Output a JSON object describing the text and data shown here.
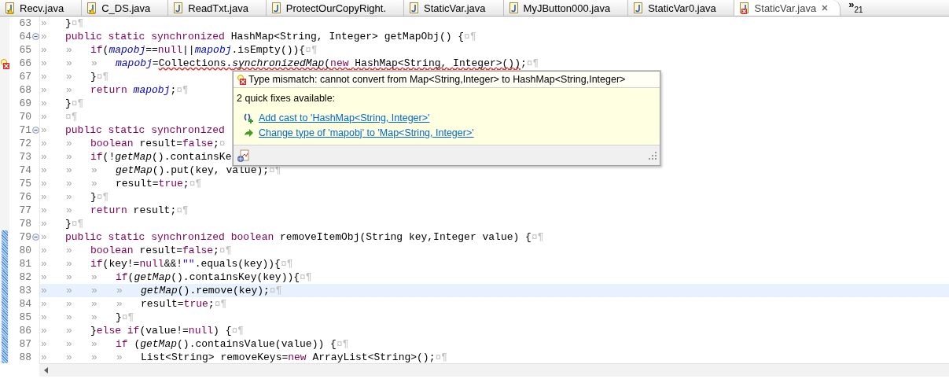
{
  "tabs": [
    {
      "label": "Recv.java",
      "warning": true,
      "error": false,
      "selected": false
    },
    {
      "label": "C_DS.java",
      "warning": true,
      "error": false,
      "selected": false
    },
    {
      "label": "ReadTxt.java",
      "warning": false,
      "error": false,
      "selected": false
    },
    {
      "label": "ProtectOurCopyRight.",
      "warning": false,
      "error": false,
      "selected": false
    },
    {
      "label": "StaticVar.java",
      "warning": false,
      "error": false,
      "selected": false
    },
    {
      "label": "MyJButton000.java",
      "warning": false,
      "error": false,
      "selected": false
    },
    {
      "label": "StaticVar0.java",
      "warning": false,
      "error": false,
      "selected": false
    },
    {
      "label": "StaticVar.java",
      "warning": false,
      "error": true,
      "selected": true
    }
  ],
  "overflow": {
    "chevron": "»",
    "count": "21"
  },
  "editor": {
    "lines": [
      {
        "number": "63",
        "foldable": false,
        "error": false,
        "changed": false,
        "current": false,
        "tokens": [
          {
            "kind": "tab",
            "text": "»"
          },
          {
            "kind": "plain",
            "text": "}"
          },
          {
            "kind": "eol",
            "text": "¤¶"
          }
        ]
      },
      {
        "number": "64",
        "foldable": true,
        "error": false,
        "changed": false,
        "current": false,
        "tokens": [
          {
            "kind": "tab",
            "text": "»"
          },
          {
            "kind": "keyword",
            "text": "public static synchronized"
          },
          {
            "kind": "plain",
            "text": " HashMap<String, Integer> getMapObj() {"
          },
          {
            "kind": "eol",
            "text": "¤¶"
          }
        ]
      },
      {
        "number": "65",
        "foldable": false,
        "error": false,
        "changed": false,
        "current": false,
        "tokens": [
          {
            "kind": "tab",
            "text": "»"
          },
          {
            "kind": "tab",
            "text": "»"
          },
          {
            "kind": "keyword",
            "text": "if"
          },
          {
            "kind": "plain",
            "text": "("
          },
          {
            "kind": "field",
            "text": "mapobj"
          },
          {
            "kind": "plain",
            "text": "=="
          },
          {
            "kind": "keyword",
            "text": "null"
          },
          {
            "kind": "plain",
            "text": "||"
          },
          {
            "kind": "field",
            "text": "mapobj"
          },
          {
            "kind": "plain",
            "text": ".isEmpty()){"
          },
          {
            "kind": "eol",
            "text": "¤¶"
          }
        ]
      },
      {
        "number": "66",
        "foldable": false,
        "error": true,
        "changed": false,
        "current": false,
        "tokens": [
          {
            "kind": "tab",
            "text": "»"
          },
          {
            "kind": "tab",
            "text": "»"
          },
          {
            "kind": "tab",
            "text": "»"
          },
          {
            "kind": "field",
            "text": "mapobj"
          },
          {
            "kind": "plain",
            "text": "="
          },
          {
            "kind": "error",
            "tokens": [
              {
                "kind": "plain",
                "text": "Collections."
              },
              {
                "kind": "static",
                "text": "synchronizedMap"
              },
              {
                "kind": "plain",
                "text": "("
              },
              {
                "kind": "keyword",
                "text": "new"
              },
              {
                "kind": "plain",
                "text": " HashMap<String, Integer>())"
              }
            ]
          },
          {
            "kind": "plain",
            "text": ";"
          },
          {
            "kind": "eol",
            "text": "¤¶"
          }
        ]
      },
      {
        "number": "67",
        "foldable": false,
        "error": false,
        "changed": false,
        "current": false,
        "tokens": [
          {
            "kind": "tab",
            "text": "»"
          },
          {
            "kind": "tab",
            "text": "»"
          },
          {
            "kind": "plain",
            "text": "}"
          },
          {
            "kind": "eol",
            "text": "¤¶"
          }
        ]
      },
      {
        "number": "68",
        "foldable": false,
        "error": false,
        "changed": false,
        "current": false,
        "tokens": [
          {
            "kind": "tab",
            "text": "»"
          },
          {
            "kind": "tab",
            "text": "»"
          },
          {
            "kind": "keyword",
            "text": "return "
          },
          {
            "kind": "field",
            "text": "mapobj"
          },
          {
            "kind": "plain",
            "text": ";"
          },
          {
            "kind": "eol",
            "text": "¤¶"
          }
        ]
      },
      {
        "number": "69",
        "foldable": false,
        "error": false,
        "changed": false,
        "current": false,
        "tokens": [
          {
            "kind": "tab",
            "text": "»"
          },
          {
            "kind": "plain",
            "text": "}"
          },
          {
            "kind": "eol",
            "text": "¤¶"
          }
        ]
      },
      {
        "number": "70",
        "foldable": false,
        "error": false,
        "changed": false,
        "current": false,
        "tokens": [
          {
            "kind": "tab",
            "text": "»"
          },
          {
            "kind": "eol",
            "text": "¤¶"
          }
        ]
      },
      {
        "number": "71",
        "foldable": true,
        "error": false,
        "changed": false,
        "current": false,
        "tokens": [
          {
            "kind": "tab",
            "text": "»"
          },
          {
            "kind": "keyword",
            "text": "public static synchronized"
          }
        ]
      },
      {
        "number": "72",
        "foldable": false,
        "error": false,
        "changed": false,
        "current": false,
        "tokens": [
          {
            "kind": "tab",
            "text": "»"
          },
          {
            "kind": "tab",
            "text": "»"
          },
          {
            "kind": "keyword",
            "text": "boolean"
          },
          {
            "kind": "plain",
            "text": " result="
          },
          {
            "kind": "keyword",
            "text": "false"
          },
          {
            "kind": "plain",
            "text": ";"
          },
          {
            "kind": "eol",
            "text": "¤"
          }
        ]
      },
      {
        "number": "73",
        "foldable": false,
        "error": false,
        "changed": false,
        "current": false,
        "tokens": [
          {
            "kind": "tab",
            "text": "»"
          },
          {
            "kind": "tab",
            "text": "»"
          },
          {
            "kind": "keyword",
            "text": "if"
          },
          {
            "kind": "plain",
            "text": "(!"
          },
          {
            "kind": "static",
            "text": "getMap"
          },
          {
            "kind": "plain",
            "text": "().containsKe"
          }
        ]
      },
      {
        "number": "74",
        "foldable": false,
        "error": false,
        "changed": false,
        "current": false,
        "tokens": [
          {
            "kind": "tab",
            "text": "»"
          },
          {
            "kind": "tab",
            "text": "»"
          },
          {
            "kind": "tab",
            "text": "»"
          },
          {
            "kind": "static",
            "text": "getMap"
          },
          {
            "kind": "plain",
            "text": "().put(key, value);"
          },
          {
            "kind": "eol",
            "text": "¤¶"
          }
        ]
      },
      {
        "number": "75",
        "foldable": false,
        "error": false,
        "changed": false,
        "current": false,
        "tokens": [
          {
            "kind": "tab",
            "text": "»"
          },
          {
            "kind": "tab",
            "text": "»"
          },
          {
            "kind": "tab",
            "text": "»"
          },
          {
            "kind": "plain",
            "text": "result="
          },
          {
            "kind": "keyword",
            "text": "true"
          },
          {
            "kind": "plain",
            "text": ";"
          },
          {
            "kind": "eol",
            "text": "¤¶"
          }
        ]
      },
      {
        "number": "76",
        "foldable": false,
        "error": false,
        "changed": false,
        "current": false,
        "tokens": [
          {
            "kind": "tab",
            "text": "»"
          },
          {
            "kind": "tab",
            "text": "»"
          },
          {
            "kind": "plain",
            "text": "}"
          },
          {
            "kind": "eol",
            "text": "¤¶"
          }
        ]
      },
      {
        "number": "77",
        "foldable": false,
        "error": false,
        "changed": false,
        "current": false,
        "tokens": [
          {
            "kind": "tab",
            "text": "»"
          },
          {
            "kind": "tab",
            "text": "»"
          },
          {
            "kind": "keyword",
            "text": "return"
          },
          {
            "kind": "plain",
            "text": " result;"
          },
          {
            "kind": "eol",
            "text": "¤¶"
          }
        ]
      },
      {
        "number": "78",
        "foldable": false,
        "error": false,
        "changed": false,
        "current": false,
        "tokens": [
          {
            "kind": "tab",
            "text": "»"
          },
          {
            "kind": "plain",
            "text": "}"
          },
          {
            "kind": "eol",
            "text": "¤¶"
          }
        ]
      },
      {
        "number": "79",
        "foldable": true,
        "error": false,
        "changed": true,
        "current": false,
        "tokens": [
          {
            "kind": "tab",
            "text": "»"
          },
          {
            "kind": "keyword",
            "text": "public static synchronized boolean"
          },
          {
            "kind": "plain",
            "text": " removeItemObj(String key,Integer value) {"
          },
          {
            "kind": "eol",
            "text": "¤¶"
          }
        ]
      },
      {
        "number": "80",
        "foldable": false,
        "error": false,
        "changed": true,
        "current": false,
        "tokens": [
          {
            "kind": "tab",
            "text": "»"
          },
          {
            "kind": "tab",
            "text": "»"
          },
          {
            "kind": "keyword",
            "text": "boolean"
          },
          {
            "kind": "plain",
            "text": " result="
          },
          {
            "kind": "keyword",
            "text": "false"
          },
          {
            "kind": "plain",
            "text": ";"
          },
          {
            "kind": "eol",
            "text": "¤¶"
          }
        ]
      },
      {
        "number": "81",
        "foldable": false,
        "error": false,
        "changed": true,
        "current": false,
        "tokens": [
          {
            "kind": "tab",
            "text": "»"
          },
          {
            "kind": "tab",
            "text": "»"
          },
          {
            "kind": "keyword",
            "text": "if"
          },
          {
            "kind": "plain",
            "text": "(key!="
          },
          {
            "kind": "keyword",
            "text": "null"
          },
          {
            "kind": "plain",
            "text": "&&!"
          },
          {
            "kind": "string",
            "text": "\"\""
          },
          {
            "kind": "plain",
            "text": ".equals(key)){"
          },
          {
            "kind": "eol",
            "text": "¤¶"
          }
        ]
      },
      {
        "number": "82",
        "foldable": false,
        "error": false,
        "changed": true,
        "current": false,
        "tokens": [
          {
            "kind": "tab",
            "text": "»"
          },
          {
            "kind": "tab",
            "text": "»"
          },
          {
            "kind": "tab",
            "text": "»"
          },
          {
            "kind": "keyword",
            "text": "if"
          },
          {
            "kind": "plain",
            "text": "("
          },
          {
            "kind": "static",
            "text": "getMap"
          },
          {
            "kind": "plain",
            "text": "().containsKey(key)){"
          },
          {
            "kind": "eol",
            "text": "¤¶"
          }
        ]
      },
      {
        "number": "83",
        "foldable": false,
        "error": false,
        "changed": true,
        "current": true,
        "tokens": [
          {
            "kind": "tab",
            "text": "»"
          },
          {
            "kind": "tab",
            "text": "»"
          },
          {
            "kind": "tab",
            "text": "»"
          },
          {
            "kind": "tab",
            "text": "»"
          },
          {
            "kind": "static",
            "text": "getMap"
          },
          {
            "kind": "plain",
            "text": "().remove(key);"
          },
          {
            "kind": "eol",
            "text": "¤¶"
          }
        ]
      },
      {
        "number": "84",
        "foldable": false,
        "error": false,
        "changed": true,
        "current": false,
        "tokens": [
          {
            "kind": "tab",
            "text": "»"
          },
          {
            "kind": "tab",
            "text": "»"
          },
          {
            "kind": "tab",
            "text": "»"
          },
          {
            "kind": "tab",
            "text": "»"
          },
          {
            "kind": "plain",
            "text": "result="
          },
          {
            "kind": "keyword",
            "text": "true"
          },
          {
            "kind": "plain",
            "text": ";"
          },
          {
            "kind": "eol",
            "text": "¤¶"
          }
        ]
      },
      {
        "number": "85",
        "foldable": false,
        "error": false,
        "changed": true,
        "current": false,
        "tokens": [
          {
            "kind": "tab",
            "text": "»"
          },
          {
            "kind": "tab",
            "text": "»"
          },
          {
            "kind": "tab",
            "text": "»"
          },
          {
            "kind": "plain",
            "text": "}"
          },
          {
            "kind": "eol",
            "text": "¤¶"
          }
        ]
      },
      {
        "number": "86",
        "foldable": false,
        "error": false,
        "changed": true,
        "current": false,
        "tokens": [
          {
            "kind": "tab",
            "text": "»"
          },
          {
            "kind": "tab",
            "text": "»"
          },
          {
            "kind": "plain",
            "text": "}"
          },
          {
            "kind": "keyword",
            "text": "else if"
          },
          {
            "kind": "plain",
            "text": "(value!="
          },
          {
            "kind": "keyword",
            "text": "null"
          },
          {
            "kind": "plain",
            "text": ") {"
          },
          {
            "kind": "eol",
            "text": "¤¶"
          }
        ]
      },
      {
        "number": "87",
        "foldable": false,
        "error": false,
        "changed": true,
        "current": false,
        "tokens": [
          {
            "kind": "tab",
            "text": "»"
          },
          {
            "kind": "tab",
            "text": "»"
          },
          {
            "kind": "tab",
            "text": "»"
          },
          {
            "kind": "keyword",
            "text": "if"
          },
          {
            "kind": "plain",
            "text": " ("
          },
          {
            "kind": "static",
            "text": "getMap"
          },
          {
            "kind": "plain",
            "text": "().containsValue(value)) {"
          },
          {
            "kind": "eol",
            "text": "¤¶"
          }
        ]
      },
      {
        "number": "88",
        "foldable": false,
        "error": false,
        "changed": true,
        "current": false,
        "tokens": [
          {
            "kind": "tab",
            "text": "»"
          },
          {
            "kind": "tab",
            "text": "»"
          },
          {
            "kind": "tab",
            "text": "»"
          },
          {
            "kind": "tab",
            "text": "»"
          },
          {
            "kind": "plain",
            "text": "List<String> removeKeys="
          },
          {
            "kind": "keyword",
            "text": "new"
          },
          {
            "kind": "plain",
            "text": " ArrayList<String>();"
          },
          {
            "kind": "eol",
            "text": "¤¶"
          }
        ]
      }
    ]
  },
  "popup": {
    "message": "Type mismatch: cannot convert from Map<String,Integer> to HashMap<String,Integer>",
    "summary": "2 quick fixes available:",
    "fixes": [
      {
        "kind": "cast",
        "label": "Add cast to 'HashMap<String, Integer>'"
      },
      {
        "kind": "change",
        "label": "Change type of 'mapobj' to 'Map<String, Integer>'"
      }
    ]
  }
}
